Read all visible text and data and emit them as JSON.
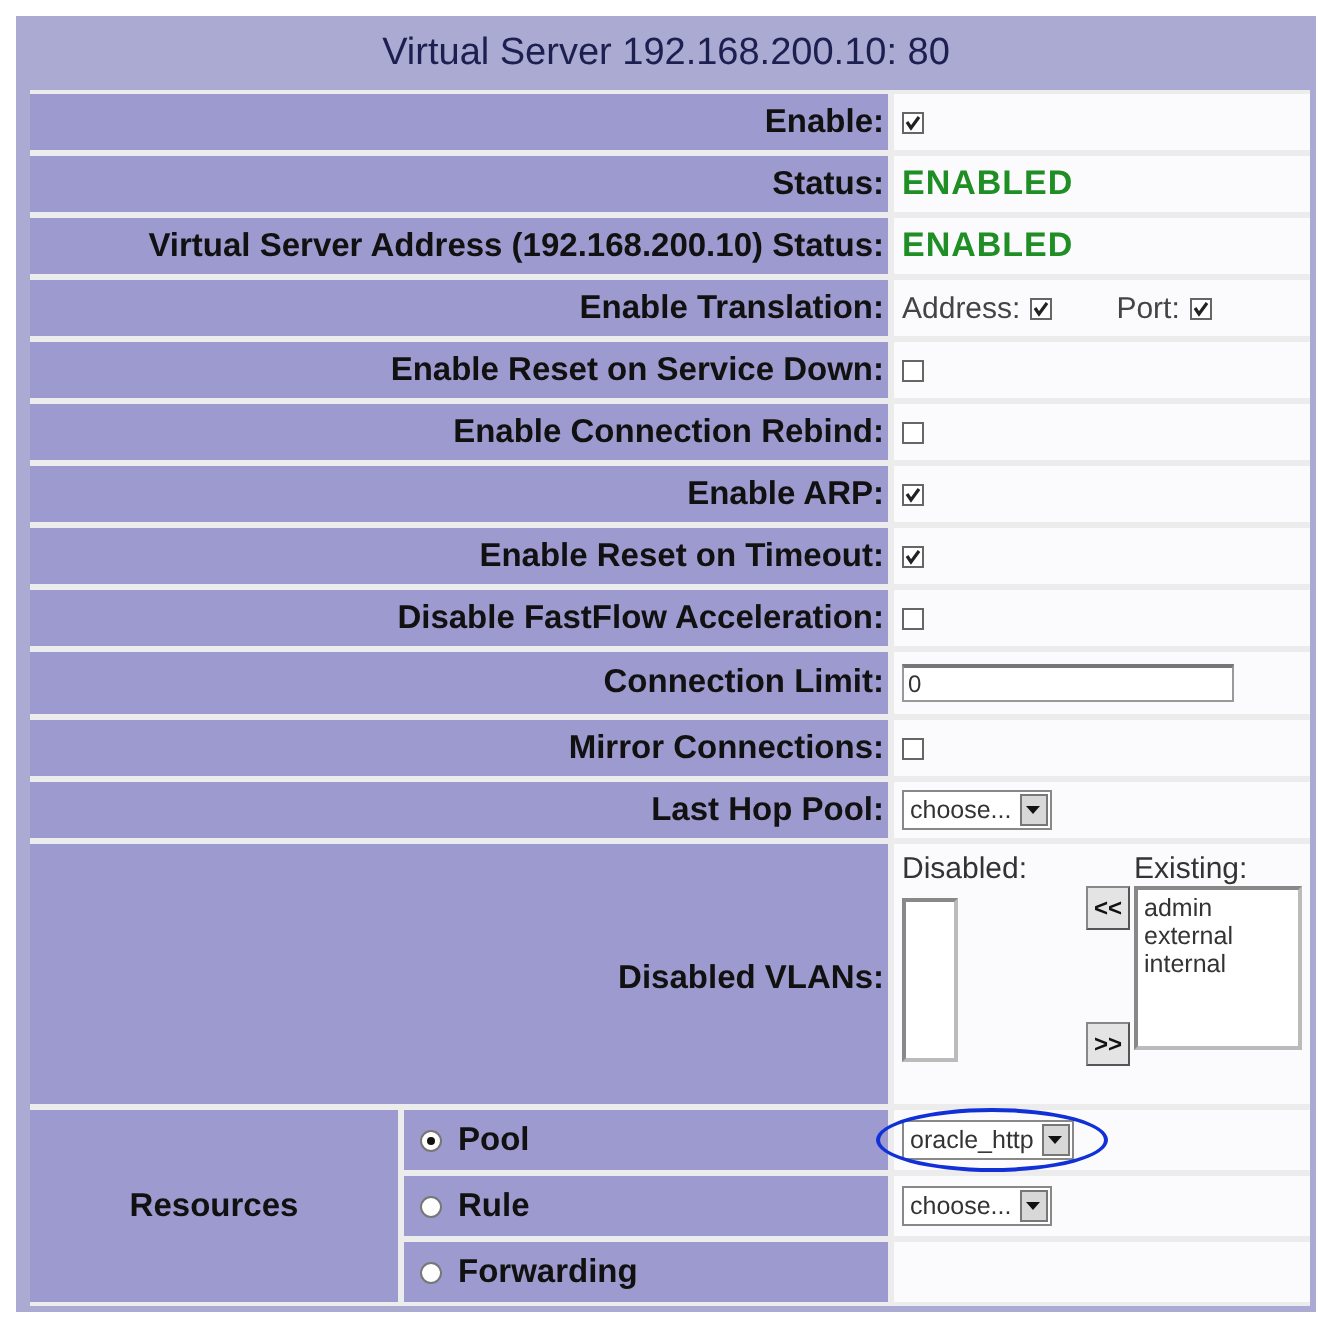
{
  "title": "Virtual Server 192.168.200.10: 80",
  "rows": [
    {
      "kind": "checkbox",
      "label": "Enable:",
      "checked": true
    },
    {
      "kind": "status",
      "label": "Status:",
      "value": "ENABLED"
    },
    {
      "kind": "status",
      "label": "Virtual Server Address (192.168.200.10) Status:",
      "value": "ENABLED"
    },
    {
      "kind": "translation",
      "label": "Enable Translation:",
      "address_label": "Address:",
      "address_checked": true,
      "port_label": "Port:",
      "port_checked": true
    },
    {
      "kind": "checkbox",
      "label": "Enable Reset on Service Down:",
      "checked": false
    },
    {
      "kind": "checkbox",
      "label": "Enable Connection Rebind:",
      "checked": false
    },
    {
      "kind": "checkbox",
      "label": "Enable ARP:",
      "checked": true
    },
    {
      "kind": "checkbox",
      "label": "Enable Reset on Timeout:",
      "checked": true
    },
    {
      "kind": "checkbox",
      "label": "Disable FastFlow Acceleration:",
      "checked": false
    },
    {
      "kind": "text_input",
      "label": "Connection Limit:",
      "value": "0"
    },
    {
      "kind": "checkbox",
      "label": "Mirror Connections:",
      "checked": false
    },
    {
      "kind": "select",
      "label": "Last Hop Pool:",
      "value": "choose..."
    },
    {
      "kind": "vlans",
      "label": "Disabled VLANs:",
      "disabled_label": "Disabled:",
      "existing_label": "Existing:",
      "add_button": "<<",
      "remove_button": ">>",
      "disabled": [],
      "existing": [
        "admin",
        "external",
        "internal"
      ]
    }
  ],
  "resources": {
    "label": "Resources",
    "options": [
      {
        "label": "Pool",
        "selected": true,
        "select": "oracle_http",
        "highlighted": true
      },
      {
        "label": "Rule",
        "selected": false,
        "select": "choose...",
        "highlighted": false
      },
      {
        "label": "Forwarding",
        "selected": false,
        "highlighted": false
      }
    ]
  }
}
